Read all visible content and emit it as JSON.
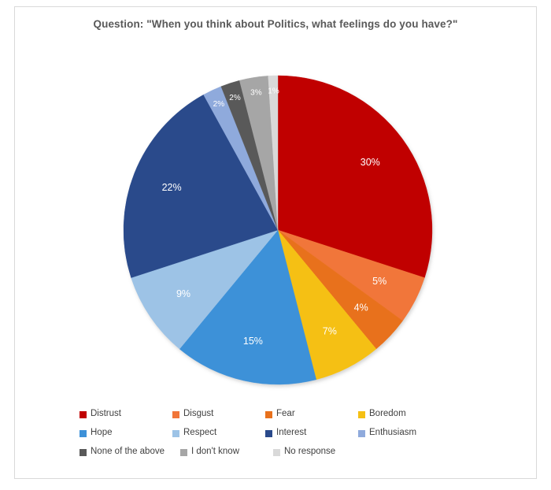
{
  "chart": {
    "title": "Question: \"When you think about Politics, what feelings do you have?\"",
    "title_color": "#595959",
    "border_color": "#d9d9d9",
    "background": "#ffffff"
  },
  "chart_data": {
    "type": "pie",
    "title": "Question: \"When you think about Politics, what feelings do you have?\"",
    "xlabel": "",
    "ylabel": "",
    "legend_position": "bottom",
    "grid": false,
    "start_angle_deg": 0,
    "direction": "clockwise",
    "categories": [
      "Distrust",
      "Disgust",
      "Fear",
      "Boredom",
      "Hope",
      "Respect",
      "Interest",
      "Enthusiasm",
      "None of the above",
      "I don't know",
      "No response"
    ],
    "values": [
      30,
      5,
      4,
      7,
      15,
      9,
      22,
      2,
      2,
      3,
      1
    ],
    "data_labels": [
      "30%",
      "5%",
      "4%",
      "7%",
      "15%",
      "9%",
      "22%",
      "2%",
      "2%",
      "3%",
      "1%"
    ],
    "colors": [
      "#C00000",
      "#F1763A",
      "#E8711C",
      "#F5C014",
      "#3D91D8",
      "#9DC3E6",
      "#2A4A8B",
      "#8FAADC",
      "#595959",
      "#A6A6A6",
      "#D9D9D9"
    ],
    "slices": [
      {
        "label": "Distrust",
        "value": 30,
        "data_label": "30%",
        "color": "#C00000"
      },
      {
        "label": "Disgust",
        "value": 5,
        "data_label": "5%",
        "color": "#F1763A"
      },
      {
        "label": "Fear",
        "value": 4,
        "data_label": "4%",
        "color": "#E8711C"
      },
      {
        "label": "Boredom",
        "value": 7,
        "data_label": "7%",
        "color": "#F5C014"
      },
      {
        "label": "Hope",
        "value": 15,
        "data_label": "15%",
        "color": "#3D91D8"
      },
      {
        "label": "Respect",
        "value": 9,
        "data_label": "9%",
        "color": "#9DC3E6"
      },
      {
        "label": "Interest",
        "value": 22,
        "data_label": "22%",
        "color": "#2A4A8B"
      },
      {
        "label": "Enthusiasm",
        "value": 2,
        "data_label": "2%",
        "color": "#8FAADC"
      },
      {
        "label": "None of the above",
        "value": 2,
        "data_label": "2%",
        "color": "#595959"
      },
      {
        "label": "I don't know",
        "value": 3,
        "data_label": "3%",
        "color": "#A6A6A6"
      },
      {
        "label": "No response",
        "value": 1,
        "data_label": "1%",
        "color": "#D9D9D9"
      }
    ]
  },
  "legend": {
    "rows": [
      [
        {
          "label": "Distrust",
          "color": "#C00000"
        },
        {
          "label": "Disgust",
          "color": "#F1763A"
        },
        {
          "label": "Fear",
          "color": "#E8711C"
        },
        {
          "label": "Boredom",
          "color": "#F5C014"
        }
      ],
      [
        {
          "label": "Hope",
          "color": "#3D91D8"
        },
        {
          "label": "Respect",
          "color": "#9DC3E6"
        },
        {
          "label": "Interest",
          "color": "#2A4A8B"
        },
        {
          "label": "Enthusiasm",
          "color": "#8FAADC"
        }
      ],
      [
        {
          "label": "None of the above",
          "color": "#595959"
        },
        {
          "label": "I don't know",
          "color": "#A6A6A6"
        },
        {
          "label": "No response",
          "color": "#D9D9D9"
        }
      ]
    ]
  }
}
